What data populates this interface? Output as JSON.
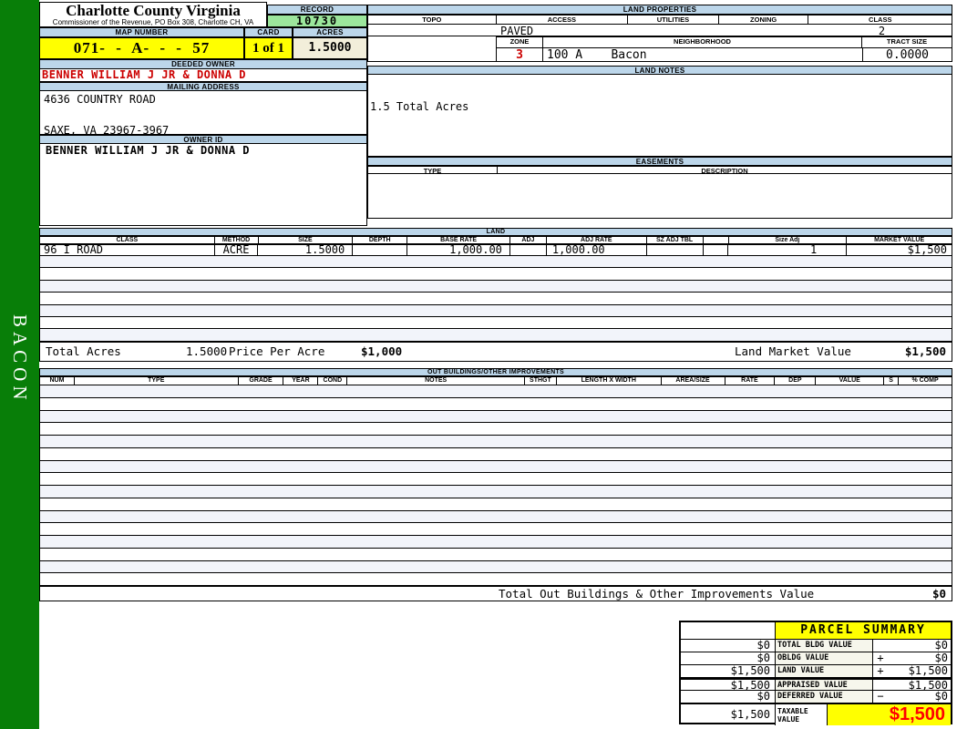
{
  "sidebar": {
    "label": "BACON"
  },
  "header": {
    "county": "Charlotte County Virginia",
    "subtitle": "Commissioner of the Revenue, PO Box 308, Charlotte CH, VA",
    "record_label": "RECORD",
    "record_value": "10730",
    "map_number_label": "MAP NUMBER",
    "map_number_value": "071- - A- - - 57",
    "card_label": "CARD",
    "card_value": "1 of 1",
    "acres_label": "ACRES",
    "acres_value": "1.5000"
  },
  "owner": {
    "deeded_owner_label": "DEEDED OWNER",
    "deeded_owner": "BENNER WILLIAM J JR & DONNA D",
    "mailing_address_label": "MAILING ADDRESS",
    "address_line1": "4636 COUNTRY ROAD",
    "address_line2": "SAXE, VA 23967-3967",
    "owner_id_label": "OWNER ID",
    "owner_id": "BENNER WILLIAM J JR & DONNA D"
  },
  "land_properties": {
    "title": "LAND PROPERTIES",
    "columns": [
      "TOPO",
      "ACCESS",
      "UTILITIES",
      "ZONING",
      "CLASS"
    ],
    "access_value": "PAVED",
    "class_value": "2",
    "zone_label": "ZONE",
    "zone_value": "3",
    "neighborhood_label": "NEIGHBORHOOD",
    "neighborhood_value": "100 A    Bacon",
    "tract_size_label": "TRACT SIZE",
    "tract_size_value": "0.0000"
  },
  "land_notes": {
    "title": "LAND NOTES",
    "note": "1.5 Total Acres"
  },
  "easements": {
    "title": "EASEMENTS",
    "type_label": "TYPE",
    "description_label": "DESCRIPTION"
  },
  "land": {
    "title": "LAND",
    "columns": [
      "CLASS",
      "METHOD",
      "SIZE",
      "DEPTH",
      "BASE RATE",
      "ADJ",
      "ADJ RATE",
      "SZ ADJ TBL",
      "",
      "Size Adj",
      "MARKET VALUE"
    ],
    "rows": [
      {
        "class": "96 I ROAD",
        "method": "ACRE",
        "size": "1.5000",
        "depth": "",
        "base_rate": "1,000.00",
        "adj": "",
        "adj_rate": "1,000.00",
        "sz_adj_tbl": "",
        "size_adj": "1",
        "market_value": "$1,500"
      }
    ],
    "totals": {
      "total_acres_label": "Total Acres",
      "total_acres": "1.5000",
      "price_per_acre_label": "Price Per Acre",
      "price_per_acre": "$1,000",
      "land_market_value_label": "Land Market Value",
      "land_market_value": "$1,500"
    }
  },
  "out_buildings": {
    "title": "OUT BUILDINGS/OTHER IMPROVEMENTS",
    "columns": [
      "NUM",
      "TYPE",
      "GRADE",
      "YEAR",
      "COND",
      "NOTES",
      "STHGT",
      "LENGTH X WIDTH",
      "AREA/SIZE",
      "RATE",
      "DEP",
      "VALUE",
      "S",
      "% COMP"
    ],
    "total_label": "Total Out Buildings & Other Improvements Value",
    "total_value": "$0"
  },
  "parcel_summary": {
    "title": "PARCEL SUMMARY",
    "rows": [
      {
        "left": "$0",
        "label": "TOTAL BLDG VALUE",
        "op": "",
        "value": "$0"
      },
      {
        "left": "$0",
        "label": "OBLDG VALUE",
        "op": "+",
        "value": "$0"
      },
      {
        "left": "$1,500",
        "label": "LAND VALUE",
        "op": "+",
        "value": "$1,500"
      },
      {
        "left": "$1,500",
        "label": "APPRAISED VALUE",
        "op": "",
        "value": "$1,500"
      },
      {
        "left": "$0",
        "label": "DEFERRED VALUE",
        "op": "−",
        "value": "$0"
      }
    ],
    "taxable": {
      "left": "$1,500",
      "label": "TAXABLE VALUE",
      "value": "$1,500"
    }
  },
  "colors": {
    "sidebar_green": "#087E08",
    "header_blue": "#BCD6EA",
    "record_green": "#9CE69C",
    "highlight_yellow": "#FFFF00",
    "acres_cream": "#F2EEDA",
    "owner_red": "#CC0000",
    "taxable_red": "#FF0000",
    "alt_row": "#F2F4FA"
  }
}
